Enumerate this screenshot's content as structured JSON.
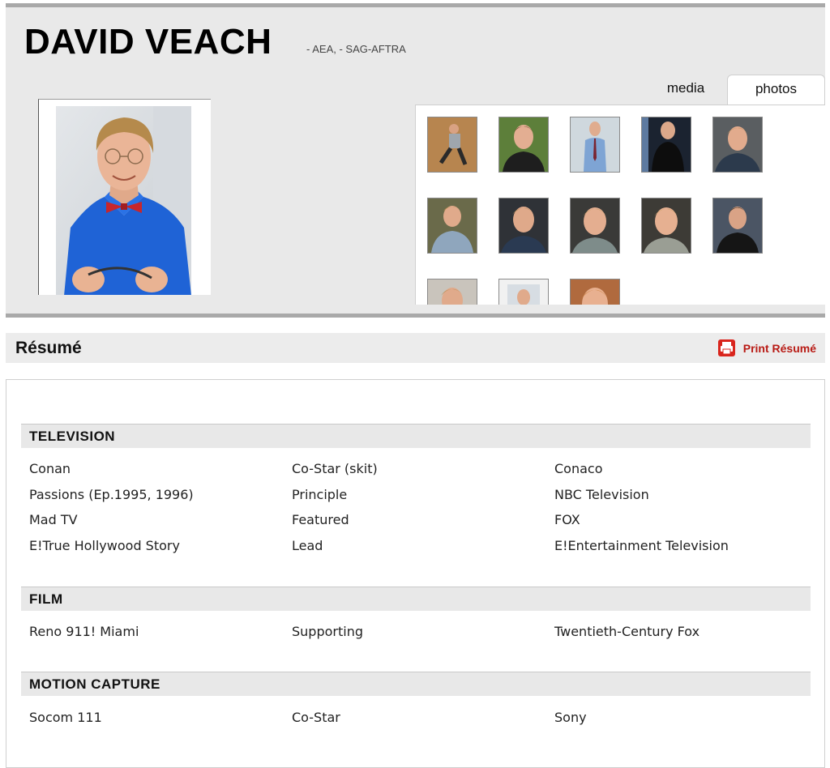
{
  "profile": {
    "name": "DAVID VEACH",
    "unions": "- AEA, - SAG-AFTRA"
  },
  "tabs": {
    "media": "media",
    "photos": "photos",
    "active": "photos"
  },
  "gallery": {
    "thumb_count": 13
  },
  "resume": {
    "title": "Résumé",
    "print_label": "Print Résumé",
    "sections": [
      {
        "heading": "TELEVISION",
        "rows": [
          [
            "Conan",
            "Co-Star (skit)",
            "Conaco"
          ],
          [
            "Passions (Ep.1995, 1996)",
            "Principle",
            "NBC Television"
          ],
          [
            "Mad TV",
            "Featured",
            "FOX"
          ],
          [
            "E!True Hollywood Story",
            "Lead",
            "E!Entertainment Television"
          ]
        ]
      },
      {
        "heading": "FILM",
        "rows": [
          [
            "Reno 911! Miami",
            "Supporting",
            "Twentieth-Century Fox"
          ]
        ]
      },
      {
        "heading": "MOTION CAPTURE",
        "rows": [
          [
            "Socom 111",
            "Co-Star",
            "Sony"
          ]
        ]
      }
    ]
  },
  "colors": {
    "accent_red": "#b81a14",
    "panel_gray": "#e9e9e9",
    "rule_gray": "#a9a9a9"
  }
}
